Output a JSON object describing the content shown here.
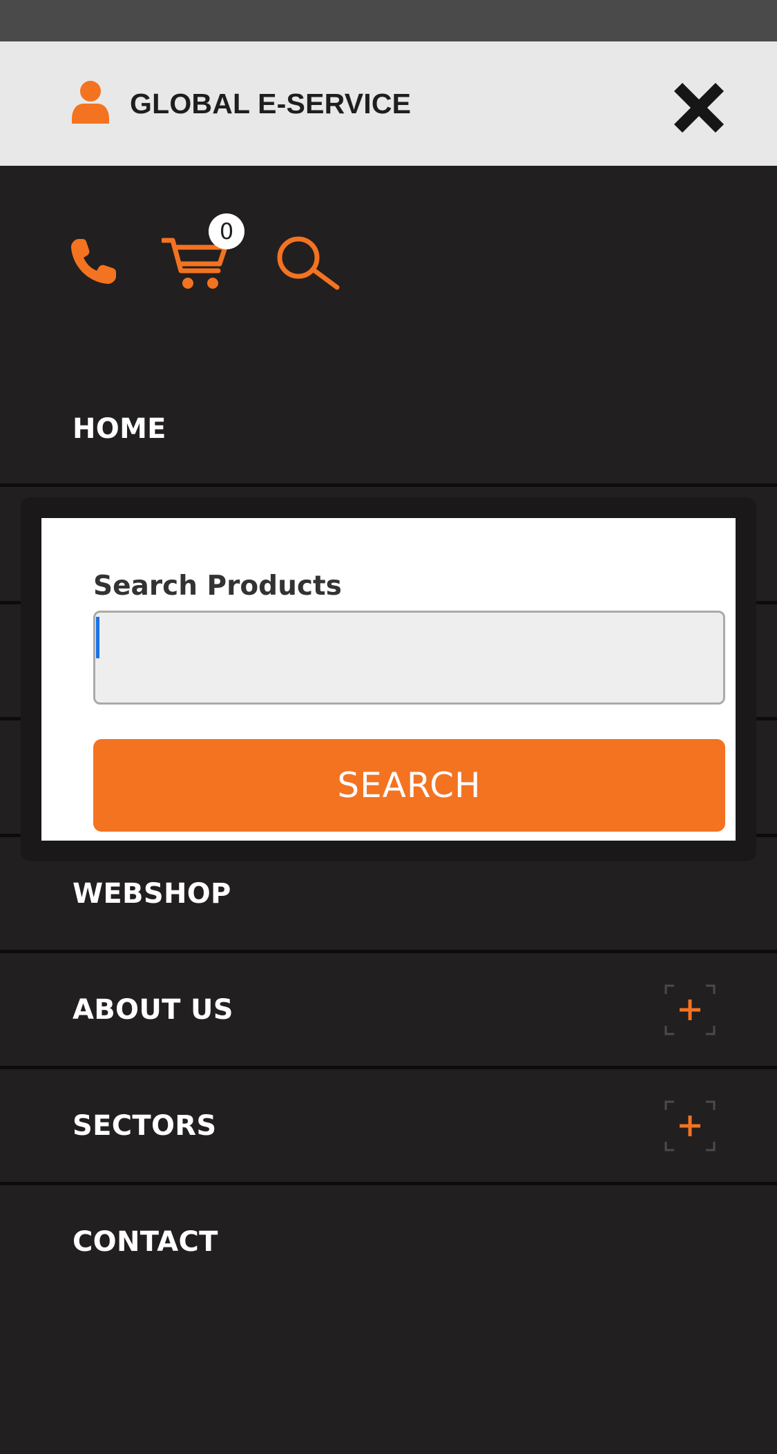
{
  "header": {
    "account_title": "GLOBAL E-SERVICE",
    "icons": {
      "user": "user-icon",
      "close": "close-icon"
    }
  },
  "toolbar": {
    "phone_icon": "phone-icon",
    "cart_icon": "cart-icon",
    "cart_count": "0",
    "search_icon": "search-icon"
  },
  "nav": {
    "items": [
      {
        "label": "HOME",
        "expandable": false
      },
      {
        "label": "",
        "expandable": false
      },
      {
        "label": "",
        "expandable": false
      },
      {
        "label": "",
        "expandable": false
      },
      {
        "label": "WEBSHOP",
        "expandable": false
      },
      {
        "label": "ABOUT US",
        "expandable": true
      },
      {
        "label": "SECTORS",
        "expandable": true
      },
      {
        "label": "CONTACT",
        "expandable": false
      }
    ]
  },
  "search": {
    "label": "Search Products",
    "value": "",
    "button_label": "SEARCH"
  },
  "colors": {
    "accent": "#f37321",
    "background": "#221f20",
    "header_bg": "#e8e8e8",
    "divider": "#0d0c0c",
    "caret": "#1a73e8"
  }
}
